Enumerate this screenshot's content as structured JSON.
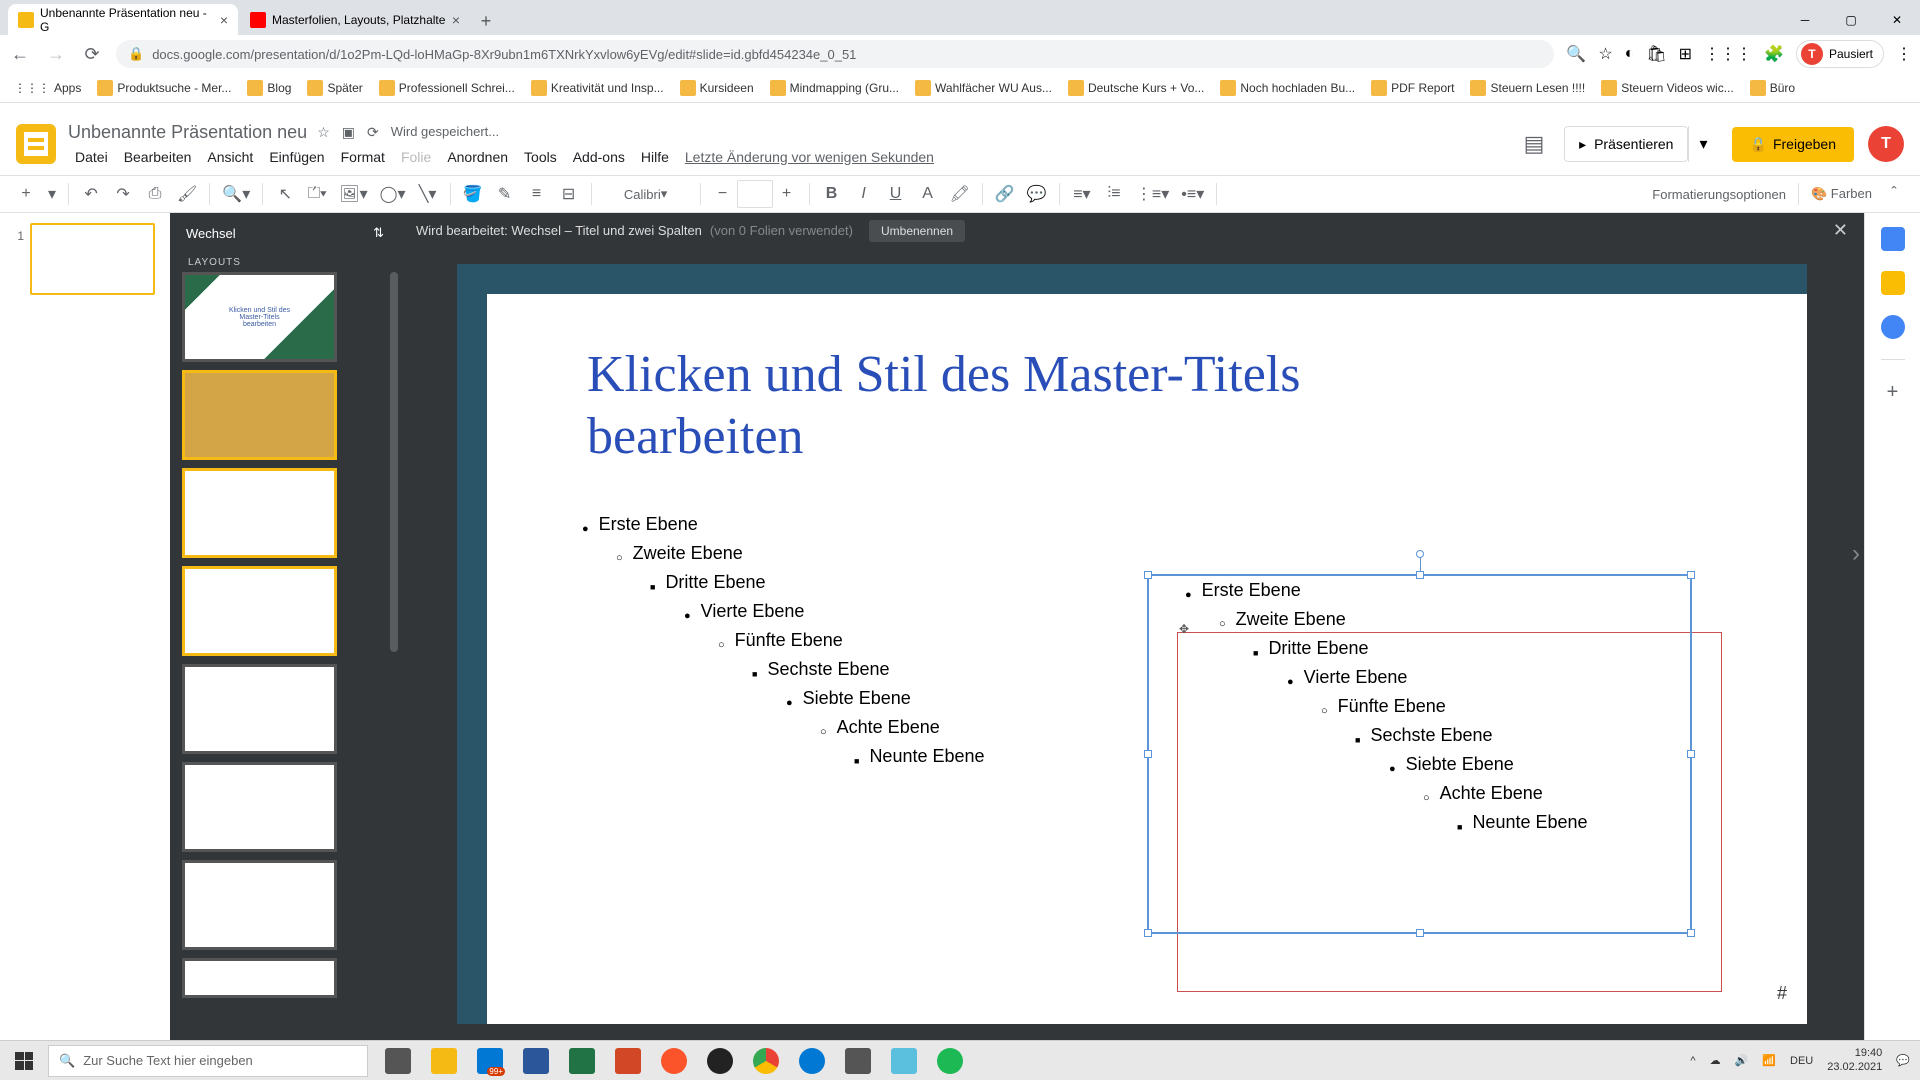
{
  "browser": {
    "tabs": [
      {
        "title": "Unbenannte Präsentation neu - G",
        "favicon_color": "#f5ba14"
      },
      {
        "title": "Masterfolien, Layouts, Platzhalte",
        "favicon_color": "#ff0000"
      }
    ],
    "url": "docs.google.com/presentation/d/1o2Pm-LQd-loHMaGp-8Xr9ubn1m6TXNrkYxvlow6yEVg/edit#slide=id.gbfd454234e_0_51",
    "profile_label": "Pausiert",
    "bookmarks": [
      "Apps",
      "Produktsuche - Mer...",
      "Blog",
      "Später",
      "Professionell Schrei...",
      "Kreativität und Insp...",
      "Kursideen",
      "Mindmapping (Gru...",
      "Wahlfächer WU Aus...",
      "Deutsche Kurs + Vo...",
      "Noch hochladen Bu...",
      "PDF Report",
      "Steuern Lesen !!!!",
      "Steuern Videos wic...",
      "Büro"
    ]
  },
  "app": {
    "title": "Unbenannte Präsentation neu",
    "save_status": "Wird gespeichert...",
    "menu": [
      "Datei",
      "Bearbeiten",
      "Ansicht",
      "Einfügen",
      "Format",
      "Folie",
      "Anordnen",
      "Tools",
      "Add-ons",
      "Hilfe"
    ],
    "last_edit": "Letzte Änderung vor wenigen Sekunden",
    "present_label": "Präsentieren",
    "share_label": "Freigeben"
  },
  "toolbar": {
    "font": "Calibri",
    "format_options": "Formatierungsoptionen",
    "colors": "Farben"
  },
  "master": {
    "theme_name": "Wechsel",
    "layouts_label": "LAYOUTS",
    "editing_label": "Wird bearbeitet: Wechsel – Titel und zwei Spalten",
    "usage": "(von 0 Folien verwendet)",
    "rename": "Umbenennen"
  },
  "slide": {
    "title": "Klicken und Stil des Master-Titels bearbeiten",
    "levels": [
      "Erste Ebene",
      "Zweite Ebene",
      "Dritte Ebene",
      "Vierte Ebene",
      "Fünfte Ebene",
      "Sechste Ebene",
      "Siebte Ebene",
      "Achte Ebene",
      "Neunte Ebene"
    ],
    "page_num": "#"
  },
  "taskbar": {
    "search_placeholder": "Zur Suche Text hier eingeben",
    "lang": "DEU",
    "time": "19:40",
    "date": "23.02.2021",
    "notif_count": "99+"
  }
}
